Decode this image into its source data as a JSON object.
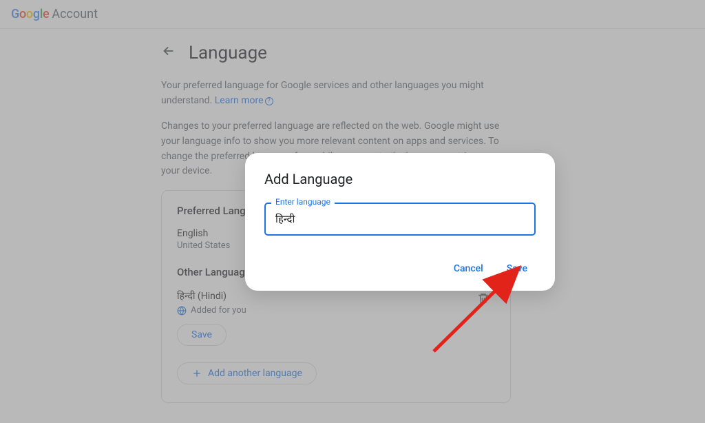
{
  "header": {
    "logo_google": "Google",
    "logo_account": "Account"
  },
  "page": {
    "title": "Language",
    "intro1_a": "Your preferred language for Google services and other languages you might understand. ",
    "learn_more": "Learn more",
    "intro2": "Changes to your preferred language are reflected on the web. Google might use your language info to show you more relevant content on apps and ser­vices. To change the preferred language for mobile apps, go to the lan­guage settings on your device."
  },
  "preferred": {
    "heading": "Preferred Language",
    "language": "English",
    "region": "United States"
  },
  "other": {
    "heading": "Other Languages",
    "lang_display": "हिन्दी (Hindi)",
    "added_for_you": "Added for you",
    "save_label": "Save"
  },
  "add_another_label": "Add another language",
  "dialog": {
    "title": "Add Language",
    "field_label": "Enter language",
    "input_value": "हिन्दी",
    "cancel": "Cancel",
    "save": "Save"
  }
}
